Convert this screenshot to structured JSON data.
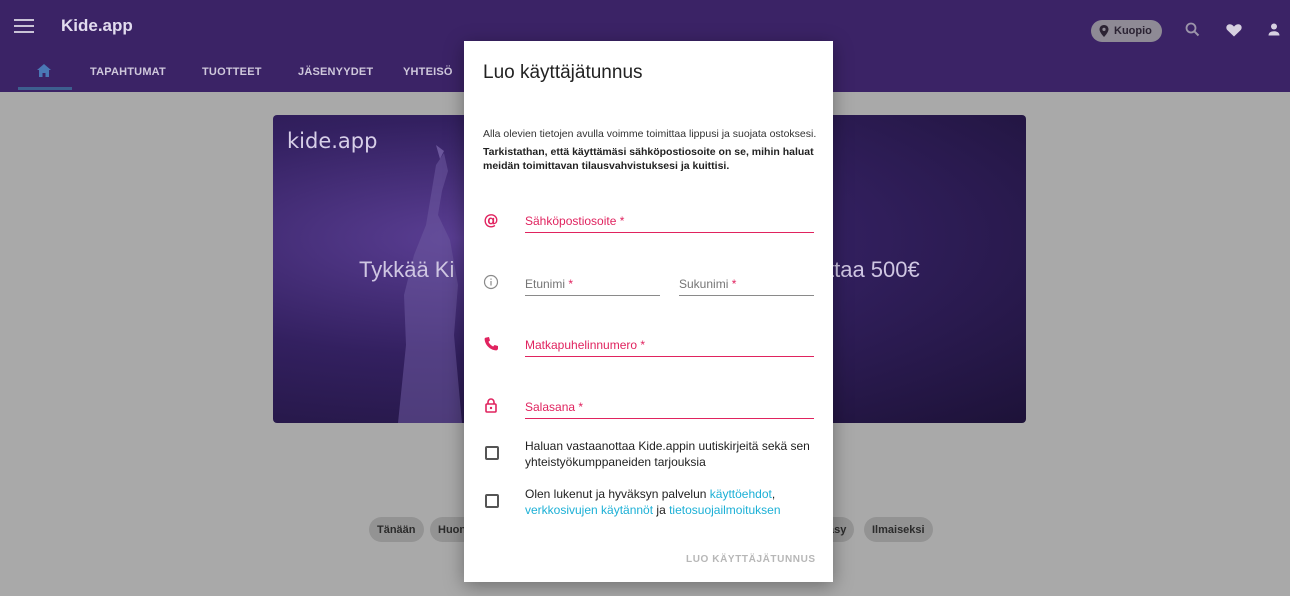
{
  "app": {
    "brand": "Kide.app",
    "location": "Kuopio"
  },
  "icons": {
    "menu": "menu-icon",
    "location": "location-pin-icon",
    "search": "search-icon",
    "favorites": "heart-icon",
    "profile": "person-icon",
    "home": "home-icon"
  },
  "nav": {
    "items": [
      "TAPAHTUMAT",
      "TUOTTEET",
      "JÄSENYYDET",
      "YHTEISÖ"
    ]
  },
  "hero": {
    "logo": "kide.app",
    "text_left": "Tykkää Ki",
    "text_right": "ttaa 500€"
  },
  "chips": [
    "Tänään",
    "Huon",
    "äsy",
    "Ilmaiseksi"
  ],
  "dialog": {
    "title": "Luo käyttäjätunnus",
    "intro": "Alla olevien tietojen avulla voimme toimittaa lippusi ja suojata ostoksesi.",
    "note": "Tarkistathan, että käyttämäsi sähköpostiosoite on se, mihin haluat meidän toimittavan tilausvahvistuksesi ja kuittisi.",
    "fields": {
      "email": {
        "label": "Sähköpostiosoite",
        "icon": "at-icon"
      },
      "first_name": {
        "label": "Etunimi",
        "icon": "info-icon"
      },
      "last_name": {
        "label": "Sukunimi"
      },
      "phone": {
        "label": "Matkapuhelinnumero",
        "icon": "phone-icon"
      },
      "password": {
        "label": "Salasana",
        "icon": "lock-icon"
      }
    },
    "required_mark": "*",
    "newsletter": "Haluan vastaanottaa Kide.appin uutiskirjeitä sekä sen yhteistyökumppaneiden tarjouksia",
    "terms": {
      "prefix": "Olen lukenut ja hyväksyn palvelun ",
      "link1": "käyttöehdot",
      "sep": ",",
      "link2": "verkkosivujen käytännöt",
      "mid": " ja ",
      "link3": "tietosuojailmoituksen"
    },
    "submit": "LUO KÄYTTÄJÄTUNNUS"
  },
  "colors": {
    "appbar": "#3b2366",
    "accent": "#e0235f",
    "link": "#1cb0d6",
    "overlay_bg": "#a9a9a9"
  }
}
